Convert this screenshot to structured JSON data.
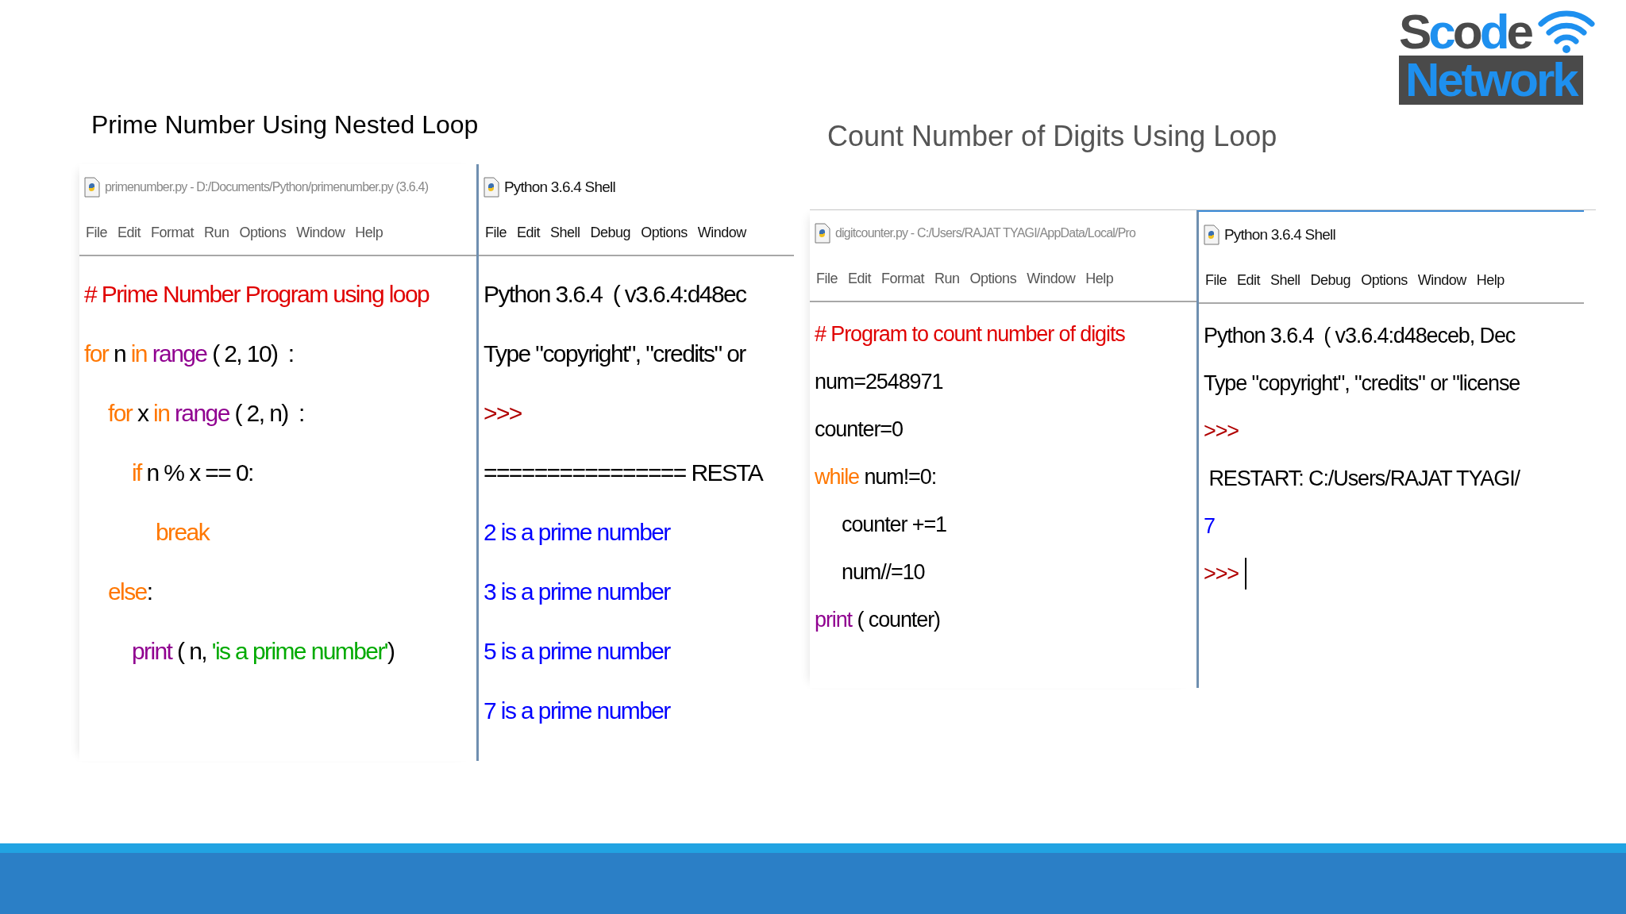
{
  "slide": {
    "logo": {
      "top": "Scode",
      "bottom": "Network"
    },
    "sections": [
      {
        "title": "Prime Number Using Nested Loop",
        "editor": {
          "title": "primenumber.py - D:/Documents/Python/primenumber.py (3.6.4)",
          "menu": [
            "File",
            "Edit",
            "Format",
            "Run",
            "Options",
            "Window",
            "Help"
          ],
          "lines": [
            {
              "tokens": [
                {
                  "kind": "comment",
                  "text": "# Prime Number Program using loop"
                }
              ]
            },
            {
              "tokens": [
                {
                  "kind": "keyword",
                  "text": "for"
                },
                {
                  "kind": "plain",
                  "text": " n "
                },
                {
                  "kind": "keyword",
                  "text": "in "
                },
                {
                  "kind": "builtin",
                  "text": "range"
                },
                {
                  "kind": "plain",
                  "text": " ( 2, 10)  :"
                }
              ],
              "children": [
                {
                  "tokens": [
                    {
                      "kind": "keyword",
                      "text": "for"
                    },
                    {
                      "kind": "plain",
                      "text": " x "
                    },
                    {
                      "kind": "keyword",
                      "text": "in "
                    },
                    {
                      "kind": "builtin",
                      "text": "range"
                    },
                    {
                      "kind": "plain",
                      "text": " ( 2, n)  :"
                    }
                  ],
                  "children": [
                    {
                      "tokens": [
                        {
                          "kind": "keyword",
                          "text": "if"
                        },
                        {
                          "kind": "plain",
                          "text": " n % x == 0:"
                        }
                      ],
                      "children": [
                        {
                          "tokens": [
                            {
                              "kind": "keyword",
                              "text": "break"
                            }
                          ]
                        }
                      ]
                    }
                  ]
                },
                {
                  "tokens": [
                    {
                      "kind": "keyword",
                      "text": "else"
                    },
                    {
                      "kind": "plain",
                      "text": ":"
                    }
                  ],
                  "children": [
                    {
                      "tokens": [
                        {
                          "kind": "builtin",
                          "text": "print"
                        },
                        {
                          "kind": "plain",
                          "text": " ( n, "
                        },
                        {
                          "kind": "string",
                          "text": "'is a prime number'"
                        },
                        {
                          "kind": "plain",
                          "text": ")"
                        }
                      ]
                    }
                  ]
                }
              ]
            }
          ]
        },
        "shell": {
          "title": "Python 3.6.4 Shell",
          "menu": [
            "File",
            "Edit",
            "Shell",
            "Debug",
            "Options",
            "Window"
          ],
          "lines": [
            {
              "tokens": [
                {
                  "kind": "plain",
                  "text": "Python 3.6.4  ( v3.6.4:d48ec"
                }
              ]
            },
            {
              "tokens": [
                {
                  "kind": "plain",
                  "text": "Type \"copyright\", \"credits\" or"
                }
              ]
            },
            {
              "tokens": [
                {
                  "kind": "prompt",
                  "text": ">>>"
                }
              ]
            },
            {
              "tokens": [
                {
                  "kind": "plain",
                  "text": "================ RESTA"
                }
              ]
            },
            {
              "tokens": [
                {
                  "kind": "output",
                  "text": "2 is a prime number"
                }
              ]
            },
            {
              "tokens": [
                {
                  "kind": "output",
                  "text": "3 is a prime number"
                }
              ]
            },
            {
              "tokens": [
                {
                  "kind": "output",
                  "text": "5 is a prime number"
                }
              ]
            },
            {
              "tokens": [
                {
                  "kind": "output",
                  "text": "7 is a prime number"
                }
              ]
            }
          ]
        }
      },
      {
        "title": "Count Number of Digits Using Loop",
        "editor": {
          "title": "digitcounter.py - C:/Users/RAJAT TYAGI/AppData/Local/Pro",
          "menu": [
            "File",
            "Edit",
            "Format",
            "Run",
            "Options",
            "Window",
            "Help"
          ],
          "lines": [
            {
              "tokens": [
                {
                  "kind": "comment",
                  "text": "# Program to count number of digits"
                }
              ]
            },
            {
              "tokens": [
                {
                  "kind": "plain",
                  "text": "num=2548971"
                }
              ]
            },
            {
              "tokens": [
                {
                  "kind": "plain",
                  "text": "counter=0"
                }
              ]
            },
            {
              "tokens": [
                {
                  "kind": "keyword",
                  "text": "while"
                },
                {
                  "kind": "plain",
                  "text": " num!=0:"
                }
              ],
              "children": [
                {
                  "tokens": [
                    {
                      "kind": "plain",
                      "text": "counter +=1"
                    }
                  ]
                },
                {
                  "tokens": [
                    {
                      "kind": "plain",
                      "text": "num//=10"
                    }
                  ]
                }
              ]
            },
            {
              "tokens": [
                {
                  "kind": "builtin",
                  "text": "print"
                },
                {
                  "kind": "plain",
                  "text": " ( counter)"
                }
              ]
            }
          ]
        },
        "shell": {
          "title": "Python 3.6.4 Shell",
          "menu": [
            "File",
            "Edit",
            "Shell",
            "Debug",
            "Options",
            "Window",
            "Help"
          ],
          "lines": [
            {
              "tokens": [
                {
                  "kind": "plain",
                  "text": "Python 3.6.4  ( v3.6.4:d48eceb, Dec"
                }
              ]
            },
            {
              "tokens": [
                {
                  "kind": "plain",
                  "text": "Type \"copyright\", \"credits\" or \"license"
                }
              ]
            },
            {
              "tokens": [
                {
                  "kind": "prompt",
                  "text": ">>>"
                }
              ]
            },
            {
              "tokens": [
                {
                  "kind": "plain",
                  "text": " RESTART: C:/Users/RAJAT TYAGI/"
                }
              ]
            },
            {
              "tokens": [
                {
                  "kind": "output",
                  "text": "7"
                }
              ]
            },
            {
              "tokens": [
                {
                  "kind": "prompt",
                  "text": ">>>"
                }
              ],
              "cursor": true
            }
          ]
        }
      }
    ]
  }
}
